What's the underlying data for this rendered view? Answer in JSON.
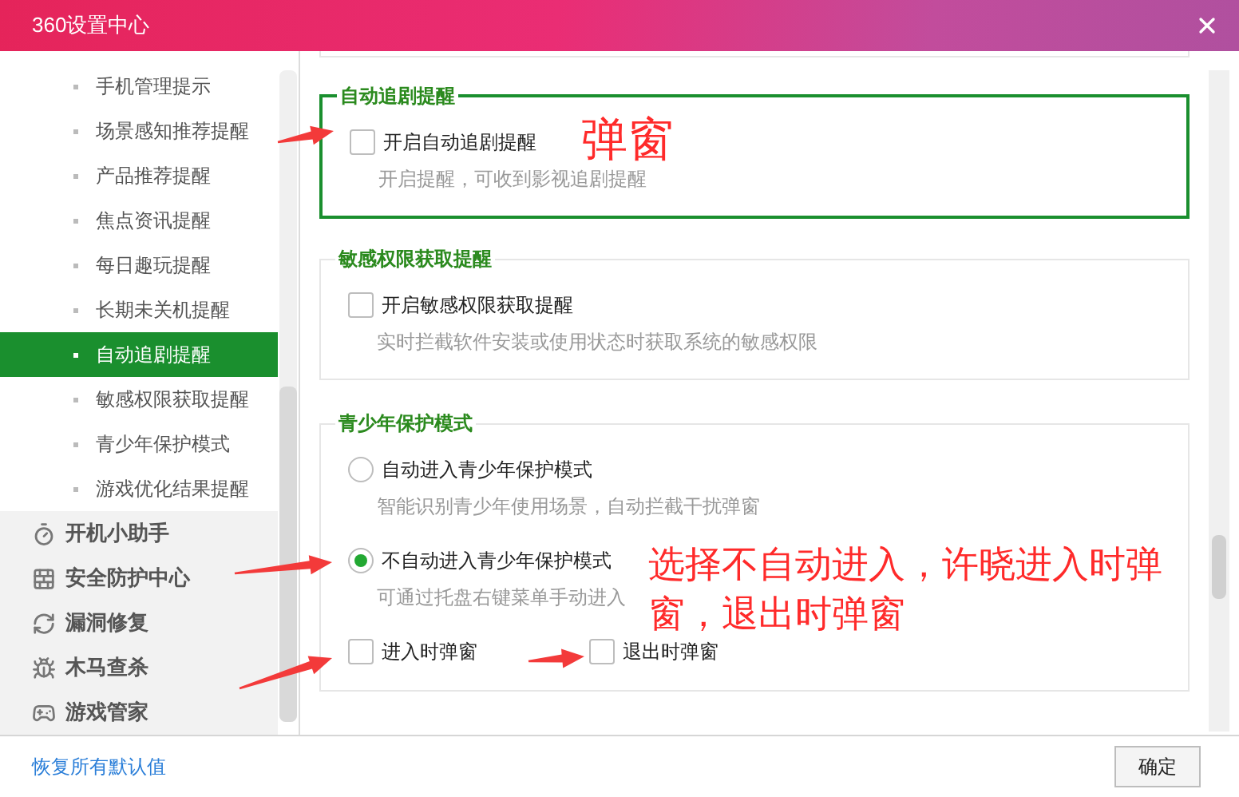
{
  "window": {
    "title": "360设置中心"
  },
  "sidebar": {
    "sub_items": [
      {
        "label": "手机管理提示",
        "selected": false
      },
      {
        "label": "场景感知推荐提醒",
        "selected": false
      },
      {
        "label": "产品推荐提醒",
        "selected": false
      },
      {
        "label": "焦点资讯提醒",
        "selected": false
      },
      {
        "label": "每日趣玩提醒",
        "selected": false
      },
      {
        "label": "长期未关机提醒",
        "selected": false
      },
      {
        "label": "自动追剧提醒",
        "selected": true
      },
      {
        "label": "敏感权限获取提醒",
        "selected": false
      },
      {
        "label": "青少年保护模式",
        "selected": false
      },
      {
        "label": "游戏优化结果提醒",
        "selected": false
      }
    ],
    "groups": [
      {
        "label": "开机小助手"
      },
      {
        "label": "安全防护中心"
      },
      {
        "label": "漏洞修复"
      },
      {
        "label": "木马查杀"
      },
      {
        "label": "游戏管家"
      }
    ]
  },
  "sections": [
    {
      "title": "自动追剧提醒",
      "highlighted": true,
      "options": [
        {
          "kind": "checkbox",
          "label": "开启自动追剧提醒",
          "checked": false,
          "description": "开启提醒，可收到影视追剧提醒"
        }
      ]
    },
    {
      "title": "敏感权限获取提醒",
      "highlighted": false,
      "options": [
        {
          "kind": "checkbox",
          "label": "开启敏感权限获取提醒",
          "checked": false,
          "description": "实时拦截软件安装或使用状态时获取系统的敏感权限"
        }
      ]
    },
    {
      "title": "青少年保护模式",
      "highlighted": false,
      "options": [
        {
          "kind": "radio",
          "label": "自动进入青少年保护模式",
          "selected": false,
          "description": "智能识别青少年使用场景，自动拦截干扰弹窗"
        },
        {
          "kind": "radio",
          "label": "不自动进入青少年保护模式",
          "selected": true,
          "description": "可通过托盘右键菜单手动进入"
        },
        {
          "kind": "checkbox_row",
          "items": [
            {
              "label": "进入时弹窗",
              "checked": false
            },
            {
              "label": "退出时弹窗",
              "checked": false
            }
          ]
        }
      ]
    }
  ],
  "annotations": [
    {
      "text": "弹窗"
    },
    {
      "text": "选择不自动进入，许晓进入时弹窗，退出时弹窗"
    }
  ],
  "footer": {
    "link": "恢复所有默认值",
    "button": "确定"
  }
}
